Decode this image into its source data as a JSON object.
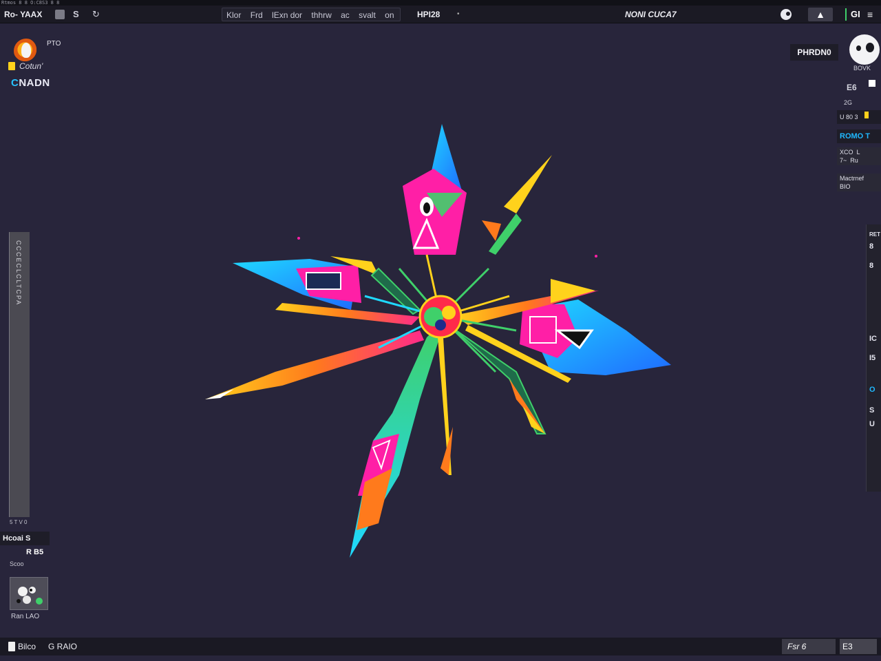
{
  "mini_strip": {
    "text": "Rtmos   8 8  O:C8S3   8 8"
  },
  "topbar": {
    "app_title": "Ro- YAAX",
    "menu": [
      "Klor",
      "Frd",
      "lExn dor",
      "thhrw",
      "ac",
      "svalt",
      "on"
    ],
    "menu_sep": "⁞",
    "hpid": "HPI28",
    "dot": "•",
    "doc_title": "NONI CUCA7",
    "up_label": "▲",
    "gi_label": "GI",
    "menu_icon": "≡"
  },
  "logo": {
    "pro": "PTO",
    "word": "Cotun'",
    "name_prefix": "C",
    "name_rest": "NADN"
  },
  "left_panel": {
    "label": "CCCECLCLTCPA",
    "footer": "5 T V 0",
    "card_title": "Hcoai  S",
    "card_value": "R B5",
    "card_sub": "Scoo",
    "thumb_caption": "Ran  LAO"
  },
  "right_panel": {
    "button": "PHRDN0",
    "avatar_caption": "BOVK",
    "value_1": "E6",
    "value_2": "2G",
    "rows": [
      "U  80  3",
      "ROMO  T",
      "XCO  L\n7~  Ru",
      "Mactrnef\nBIO"
    ]
  },
  "right_tools": [
    "RET",
    "8",
    "8",
    "IC",
    "I5",
    "O",
    "S",
    "U"
  ],
  "bottombar": {
    "left_label": "Bilco",
    "mid_label": "G RAIO",
    "status": "Fsr  6",
    "zoom": "E3"
  },
  "colors": {
    "background": "#28253b",
    "panel": "#1b1a24",
    "accent_green": "#3fd06a",
    "accent_blue": "#1fb9ff",
    "badge_yellow": "#ffd21c"
  }
}
